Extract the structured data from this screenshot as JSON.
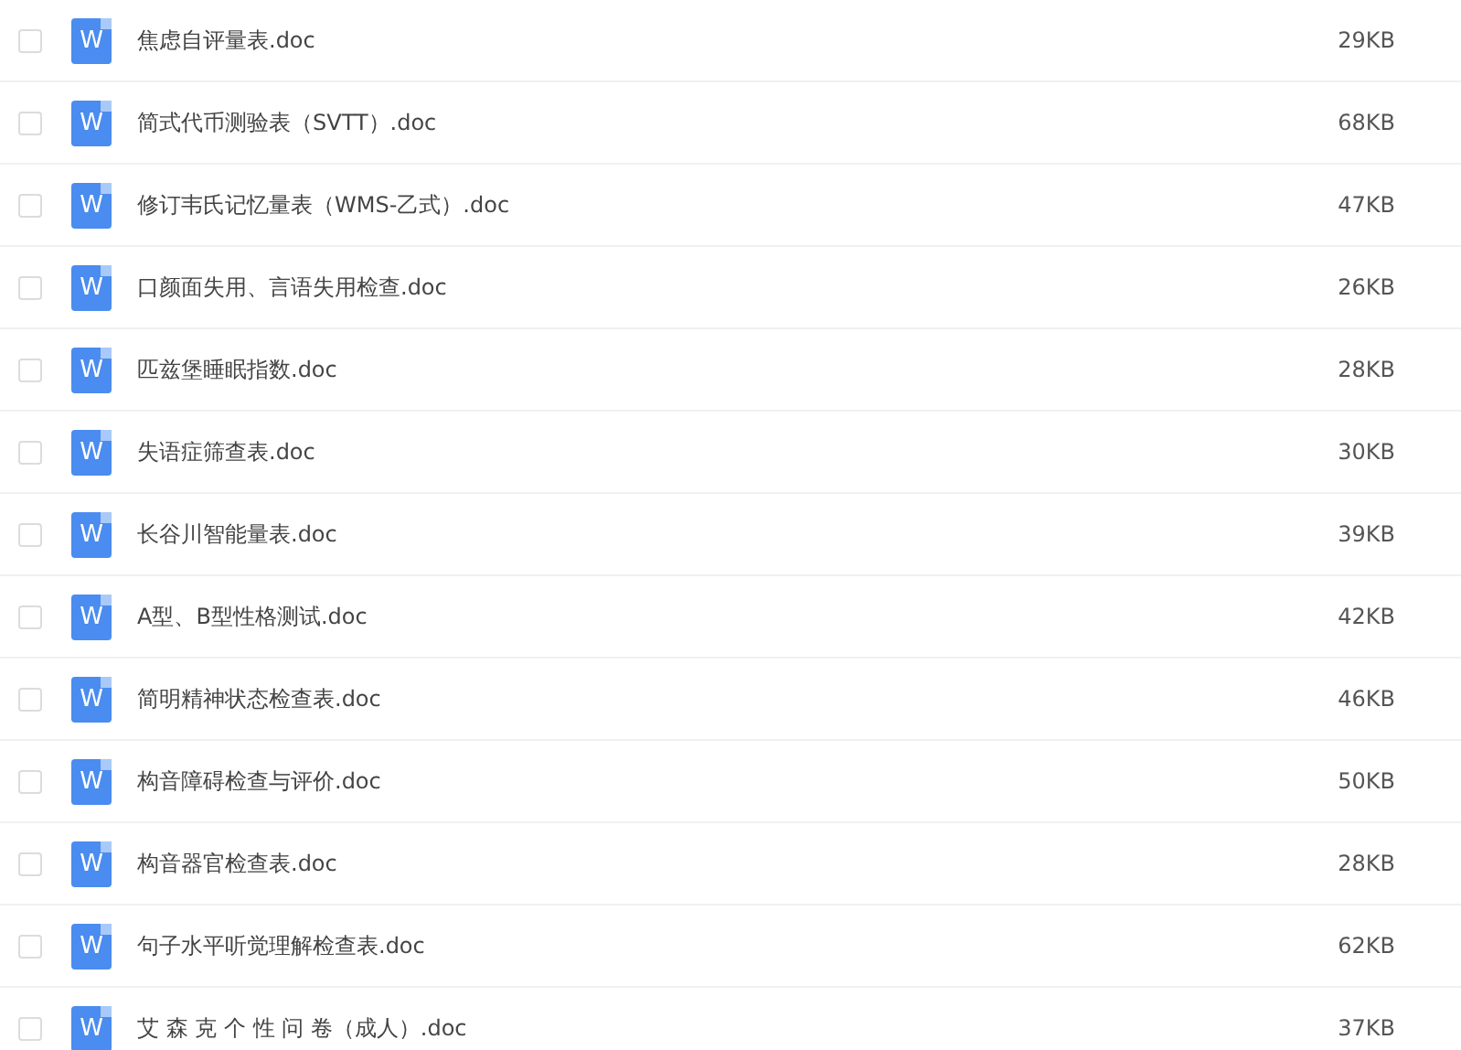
{
  "files": [
    {
      "name": "焦虑自评量表.doc",
      "size": "29KB",
      "checked": false,
      "icon_text": "W"
    },
    {
      "name": "简式代币测验表（SVTT）.doc",
      "size": "68KB",
      "checked": false,
      "icon_text": "W"
    },
    {
      "name": "修订韦氏记忆量表（WMS-乙式）.doc",
      "size": "47KB",
      "checked": false,
      "icon_text": "W"
    },
    {
      "name": "口颜面失用、言语失用检查.doc",
      "size": "26KB",
      "checked": false,
      "icon_text": "W"
    },
    {
      "name": "匹兹堡睡眠指数.doc",
      "size": "28KB",
      "checked": false,
      "icon_text": "W"
    },
    {
      "name": "失语症筛查表.doc",
      "size": "30KB",
      "checked": false,
      "icon_text": "W"
    },
    {
      "name": "长谷川智能量表.doc",
      "size": "39KB",
      "checked": false,
      "icon_text": "W"
    },
    {
      "name": "A型、B型性格测试.doc",
      "size": "42KB",
      "checked": false,
      "icon_text": "W"
    },
    {
      "name": "简明精神状态检查表.doc",
      "size": "46KB",
      "checked": false,
      "icon_text": "W"
    },
    {
      "name": "构音障碍检查与评价.doc",
      "size": "50KB",
      "checked": false,
      "icon_text": "W"
    },
    {
      "name": "构音器官检查表.doc",
      "size": "28KB",
      "checked": false,
      "icon_text": "W"
    },
    {
      "name": "句子水平听觉理解检查表.doc",
      "size": "62KB",
      "checked": false,
      "icon_text": "W"
    },
    {
      "name": "艾 森 克 个 性 问 卷（成人）.doc",
      "size": "37KB",
      "checked": false,
      "icon_text": "W"
    }
  ]
}
